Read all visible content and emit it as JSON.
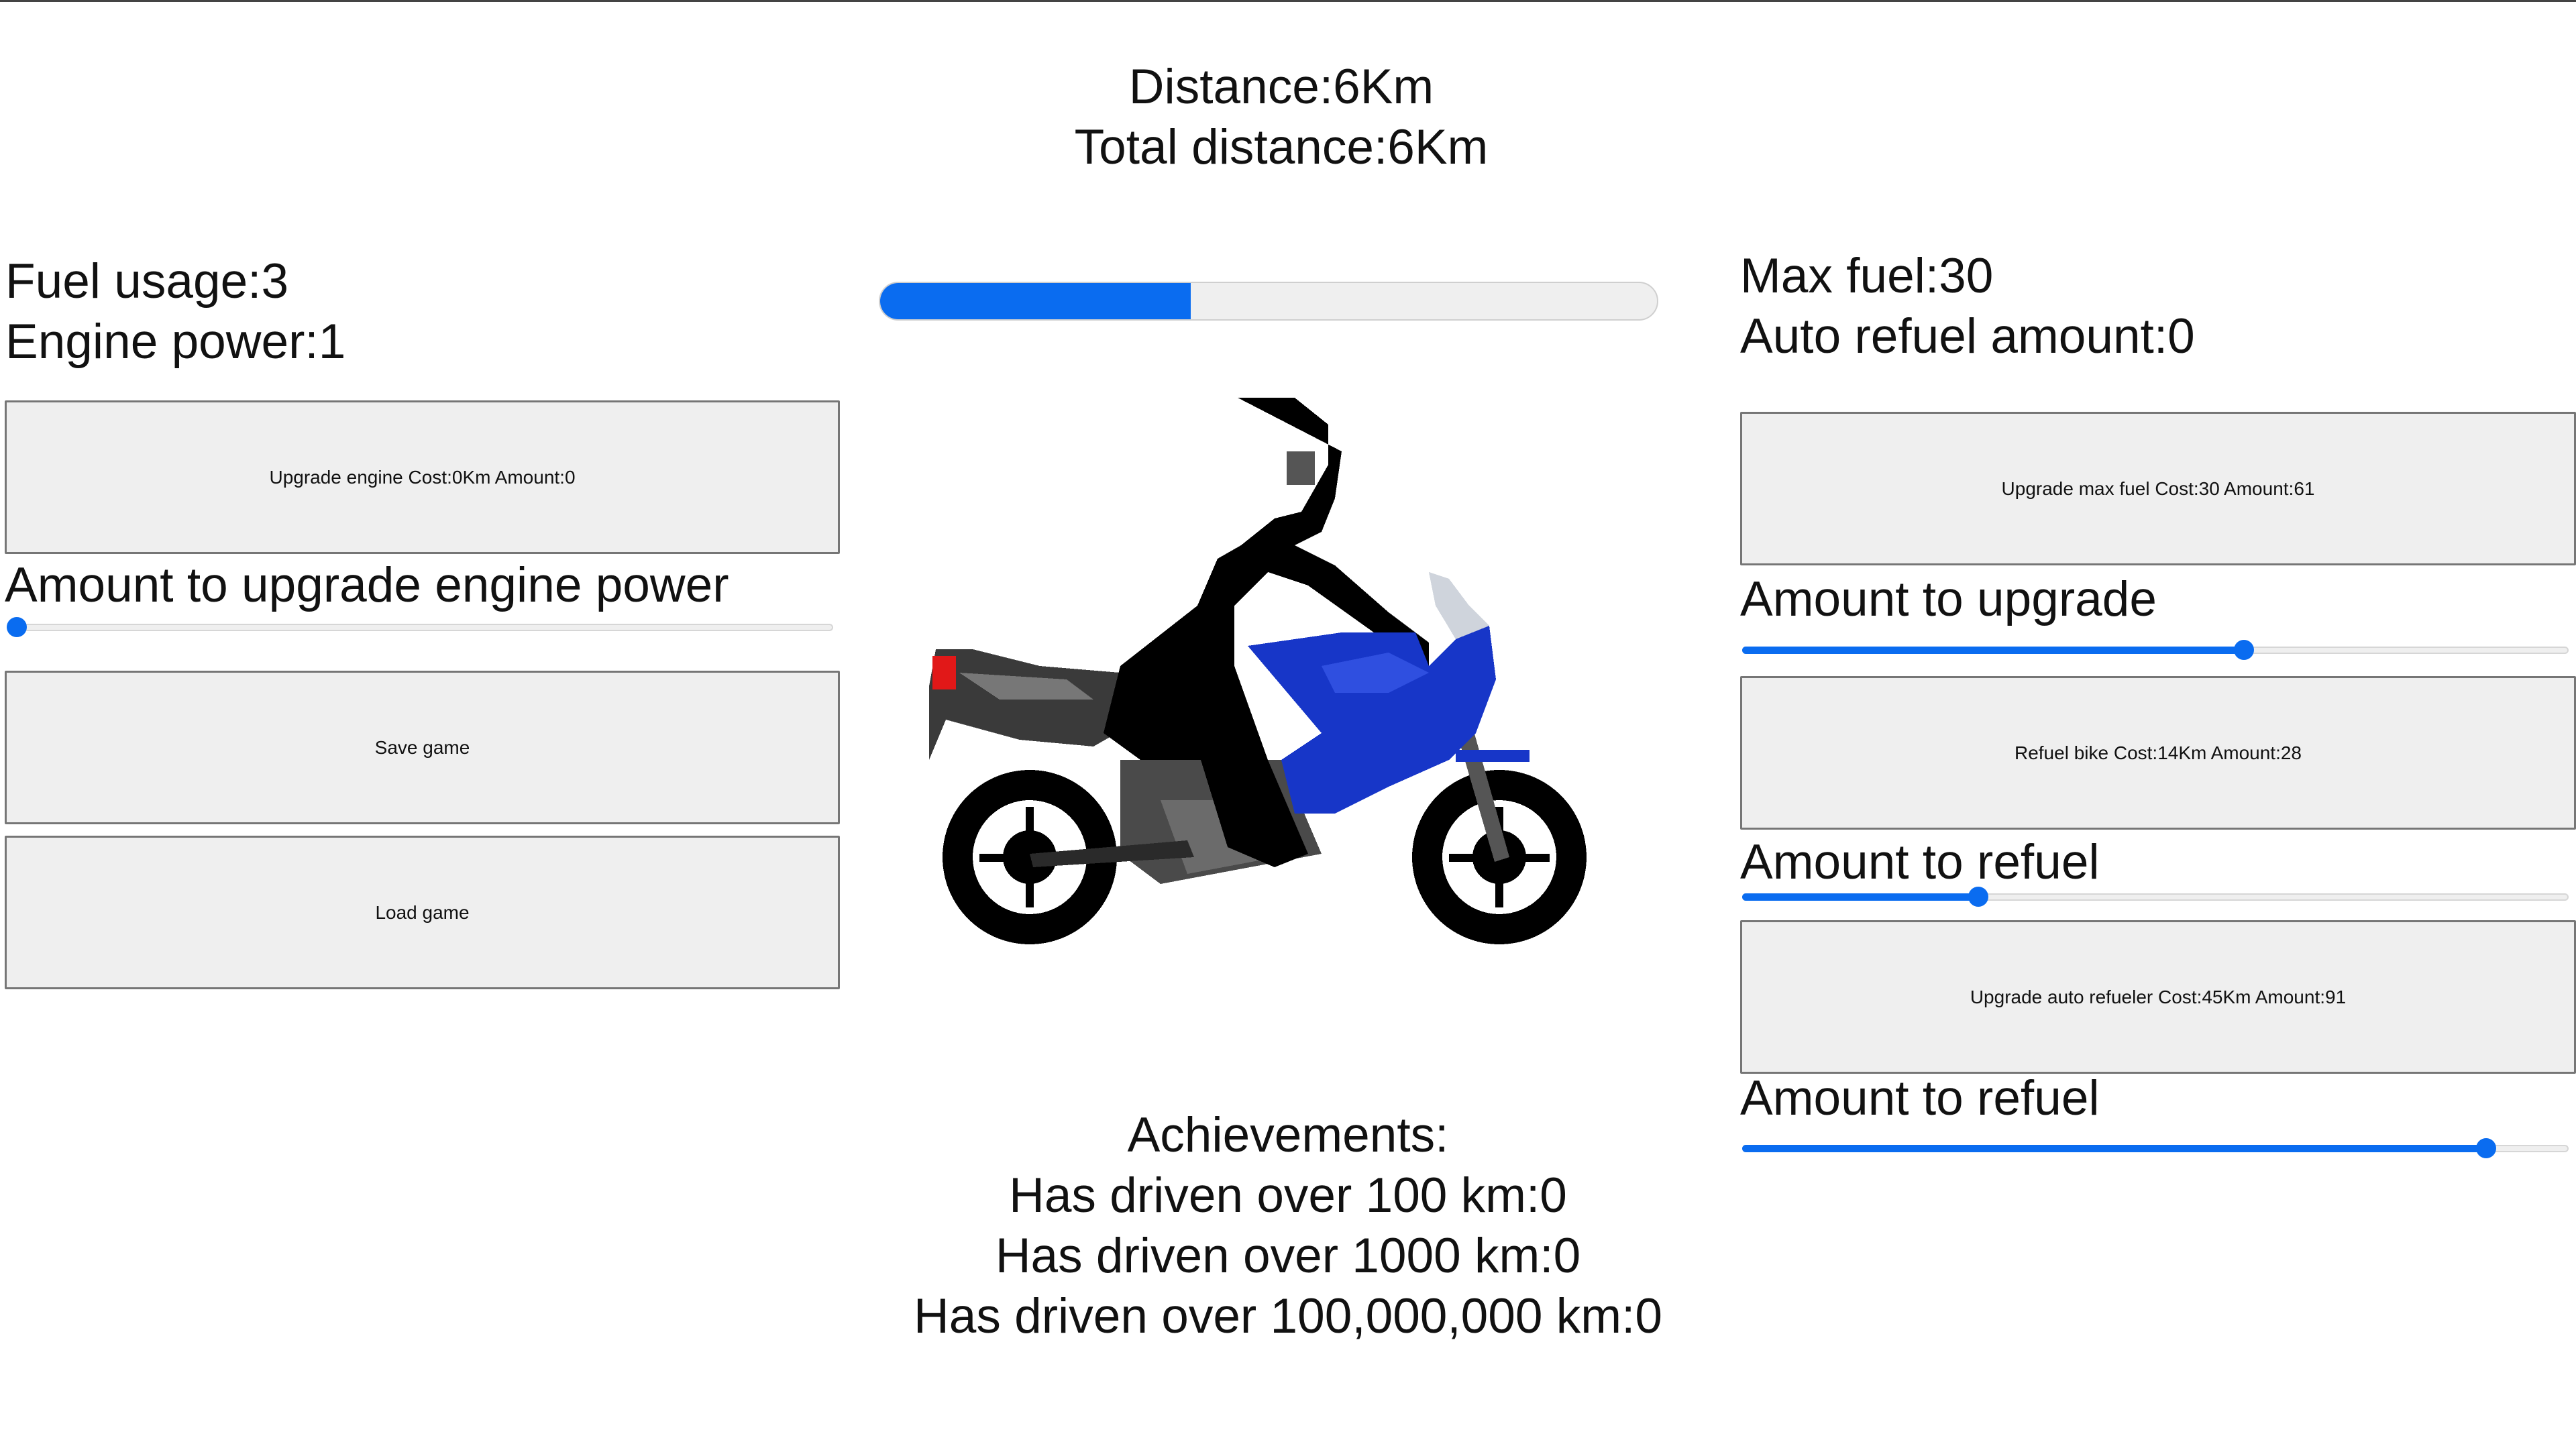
{
  "stats": {
    "distance": "Distance:6Km",
    "total_distance": "Total distance:6Km",
    "fuel_usage": "Fuel usage:3",
    "engine_power": "Engine power:1",
    "max_fuel": "Max fuel:30",
    "auto_refuel_amount": "Auto refuel amount:0"
  },
  "progress": {
    "fraction": 0.4
  },
  "left_panel": {
    "upgrade_engine_button": "Upgrade engine Cost:0Km Amount:0",
    "engine_slider_label": "Amount to upgrade engine power",
    "engine_slider_value": 0.0,
    "save_button": "Save game",
    "load_button": "Load game"
  },
  "right_panel": {
    "upgrade_max_fuel_button": "Upgrade max fuel Cost:30 Amount:61",
    "max_fuel_slider_label": "Amount to upgrade",
    "max_fuel_slider_value": 0.61,
    "refuel_button": "Refuel bike Cost:14Km Amount:28",
    "refuel_slider_label": "Amount to refuel",
    "refuel_slider_value": 0.28,
    "auto_refueler_button": "Upgrade auto refueler Cost:45Km Amount:91",
    "auto_refuel_slider_label": "Amount to refuel",
    "auto_refuel_slider_value": 0.91
  },
  "achievements": {
    "title": "Achievements:",
    "items": [
      "Has driven over 100 km:0",
      "Has driven over 1000 km:0",
      "Has driven over 100,000,000 km:0"
    ]
  },
  "colors": {
    "accent": "#0a6cf0",
    "bike_blue": "#1736c8",
    "rider": "#000000"
  },
  "icons": {
    "bike": "motorcycle-rider-pixel-art"
  }
}
